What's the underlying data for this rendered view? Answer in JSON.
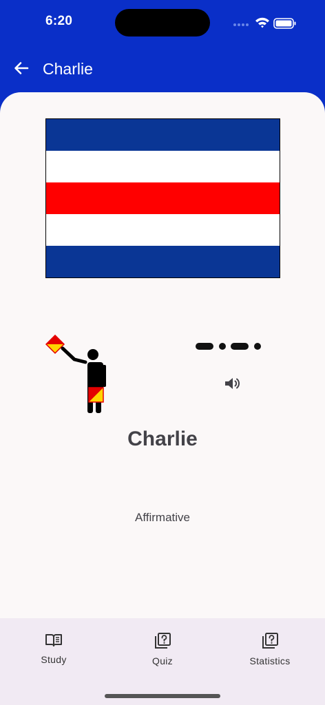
{
  "status_bar": {
    "time": "6:20"
  },
  "header": {
    "title": "Charlie"
  },
  "card": {
    "name": "Charlie",
    "meaning": "Affirmative",
    "morse": "-.-.",
    "flag_colors": [
      "#0a3695",
      "#ffffff",
      "#ff0000",
      "#ffffff",
      "#0a3695"
    ]
  },
  "nav": [
    {
      "label": "Study",
      "icon": "book-icon"
    },
    {
      "label": "Quiz",
      "icon": "quiz-icon"
    },
    {
      "label": "Statistics",
      "icon": "quiz-icon"
    }
  ],
  "colors": {
    "app_bar": "#0a2fc8",
    "sheet": "#fbf8f8",
    "nav_bar": "#f1eaf3"
  }
}
